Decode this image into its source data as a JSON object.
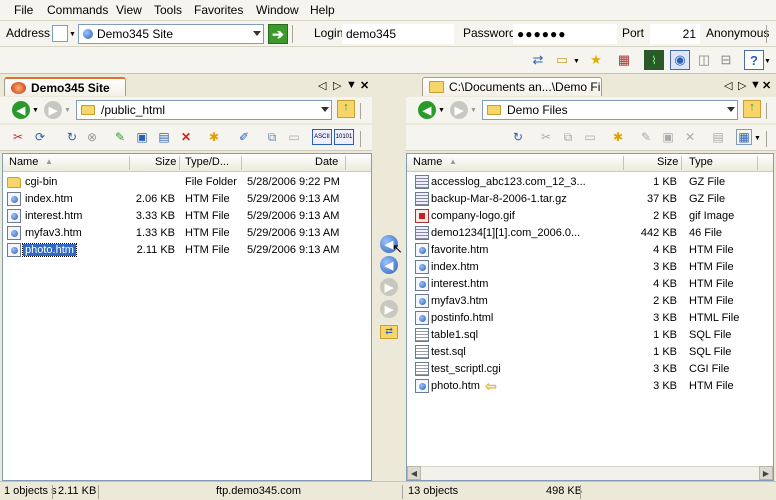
{
  "menu": [
    {
      "label": "File"
    },
    {
      "label": "Commands"
    },
    {
      "label": "View"
    },
    {
      "label": "Tools"
    },
    {
      "label": "Favorites"
    },
    {
      "label": "Window"
    },
    {
      "label": "Help"
    }
  ],
  "address": {
    "label": "Address",
    "site": "Demo345 Site",
    "login_label": "Login",
    "login": "demo345",
    "password_label": "Password",
    "password": "●●●●●●",
    "port_label": "Port",
    "port": "21",
    "anonymous_label": "Anonymous"
  },
  "left": {
    "tab_title": "Demo345 Site",
    "path": "/public_html",
    "columns": {
      "name": "Name",
      "size": "Size",
      "type": "Type/D...",
      "date": "Date"
    },
    "rows": [
      {
        "name": "cgi-bin",
        "size": "",
        "type": "File Folder",
        "date": "5/28/2006 9:22 PM",
        "icon": "folder-icon"
      },
      {
        "name": "index.htm",
        "size": "2.06 KB",
        "type": "HTM File",
        "date": "5/29/2006 9:13 AM",
        "icon": "html-file-icon"
      },
      {
        "name": "interest.htm",
        "size": "3.33 KB",
        "type": "HTM File",
        "date": "5/29/2006 9:13 AM",
        "icon": "html-file-icon"
      },
      {
        "name": "myfav3.htm",
        "size": "1.33 KB",
        "type": "HTM File",
        "date": "5/29/2006 9:13 AM",
        "icon": "html-file-icon"
      },
      {
        "name": "photo.htm",
        "size": "2.11 KB",
        "type": "HTM File",
        "date": "5/29/2006 9:13 AM",
        "icon": "html-file-icon",
        "selected": true
      }
    ]
  },
  "right": {
    "tab_title": "C:\\Documents an...\\Demo Files",
    "path": "Demo Files",
    "columns": {
      "name": "Name",
      "size": "Size",
      "type": "Type"
    },
    "rows": [
      {
        "name": "accesslog_abc123.com_12_3...",
        "size": "1 KB",
        "type": "GZ File",
        "icon": "archive-icon"
      },
      {
        "name": "backup-Mar-8-2006-1.tar.gz",
        "size": "37 KB",
        "type": "GZ File",
        "icon": "archive-icon"
      },
      {
        "name": "company-logo.gif",
        "size": "2 KB",
        "type": "gif Image",
        "icon": "image-icon"
      },
      {
        "name": "demo1234[1][1].com_2006.0...",
        "size": "442 KB",
        "type": "46 File",
        "icon": "archive-icon"
      },
      {
        "name": "favorite.htm",
        "size": "4 KB",
        "type": "HTM File",
        "icon": "html-file-icon"
      },
      {
        "name": "index.htm",
        "size": "3 KB",
        "type": "HTM File",
        "icon": "html-file-icon"
      },
      {
        "name": "interest.htm",
        "size": "4 KB",
        "type": "HTM File",
        "icon": "html-file-icon"
      },
      {
        "name": "myfav3.htm",
        "size": "2 KB",
        "type": "HTM File",
        "icon": "html-file-icon"
      },
      {
        "name": "postinfo.html",
        "size": "3 KB",
        "type": "HTML File",
        "icon": "html-file-icon"
      },
      {
        "name": "table1.sql",
        "size": "1 KB",
        "type": "SQL File",
        "icon": "text-file-icon"
      },
      {
        "name": "test.sql",
        "size": "1 KB",
        "type": "SQL File",
        "icon": "text-file-icon"
      },
      {
        "name": "test_scriptl.cgi",
        "size": "3 KB",
        "type": "CGI File",
        "icon": "text-file-icon"
      },
      {
        "name": "photo.htm",
        "size": "3 KB",
        "type": "HTM File",
        "icon": "html-file-icon",
        "highlighted": true
      }
    ]
  },
  "status": {
    "left_objects": "1 objects s",
    "left_size": "2.11 KB",
    "server": "ftp.demo345.com",
    "right_objects": "13 objects",
    "right_size": "498 KB"
  },
  "colors": {
    "selection": "#316ac5",
    "accent_tab": "#e07030",
    "arrow_highlight": "#f0c020"
  }
}
